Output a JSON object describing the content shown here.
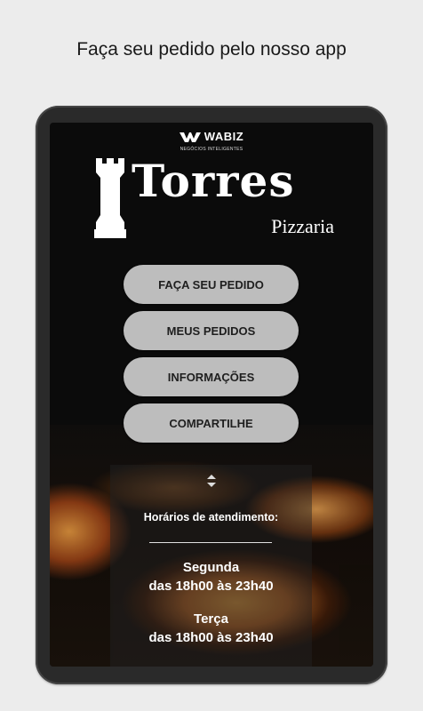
{
  "caption": "Faça seu pedido pelo nosso app",
  "wabiz": {
    "name": "WABIZ",
    "tagline": "NEGÓCIOS INTELIGENTES"
  },
  "logo": {
    "title": "Torres",
    "subtitle": "Pizzaria"
  },
  "menu": [
    {
      "label": "FAÇA SEU PEDIDO"
    },
    {
      "label": "MEUS PEDIDOS"
    },
    {
      "label": "INFORMAÇÕES"
    },
    {
      "label": "COMPARTILHE"
    }
  ],
  "hours": {
    "title": "Horários de atendimento:",
    "days": [
      {
        "day": "Segunda",
        "time": "das 18h00 às 23h40"
      },
      {
        "day": "Terça",
        "time": "das 18h00 às 23h40"
      }
    ]
  },
  "colors": {
    "button_bg": "#bdbdbd",
    "screen_bg": "#0b0b0b",
    "page_bg": "#ececec"
  }
}
